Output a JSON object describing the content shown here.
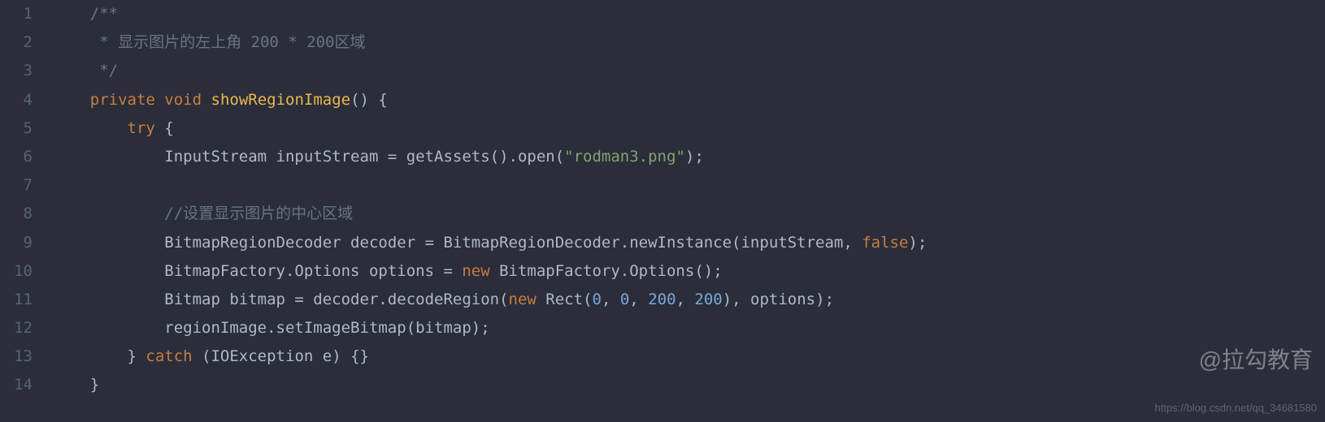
{
  "lines": [
    {
      "num": "1",
      "tokens": [
        {
          "cls": "tk-comment",
          "text": "/**"
        }
      ],
      "indent": 1
    },
    {
      "num": "2",
      "tokens": [
        {
          "cls": "tk-comment",
          "text": " * 显示图片的左上角 200 * 200区域"
        }
      ],
      "indent": 1
    },
    {
      "num": "3",
      "tokens": [
        {
          "cls": "tk-comment",
          "text": " */"
        }
      ],
      "indent": 1
    },
    {
      "num": "4",
      "tokens": [
        {
          "cls": "tk-keyword",
          "text": "private"
        },
        {
          "cls": "",
          "text": " "
        },
        {
          "cls": "tk-keyword",
          "text": "void"
        },
        {
          "cls": "",
          "text": " "
        },
        {
          "cls": "tk-method",
          "text": "showRegionImage"
        },
        {
          "cls": "",
          "text": "() {"
        }
      ],
      "indent": 1
    },
    {
      "num": "5",
      "tokens": [
        {
          "cls": "tk-keyword",
          "text": "try"
        },
        {
          "cls": "",
          "text": " {"
        }
      ],
      "indent": 2
    },
    {
      "num": "6",
      "tokens": [
        {
          "cls": "tk-type",
          "text": "InputStream inputStream = getAssets().open("
        },
        {
          "cls": "tk-string",
          "text": "\"rodman3.png\""
        },
        {
          "cls": "",
          "text": ");"
        }
      ],
      "indent": 3
    },
    {
      "num": "7",
      "tokens": [],
      "indent": 0
    },
    {
      "num": "8",
      "tokens": [
        {
          "cls": "tk-comment",
          "text": "//设置显示图片的中心区域"
        }
      ],
      "indent": 3
    },
    {
      "num": "9",
      "tokens": [
        {
          "cls": "",
          "text": "BitmapRegionDecoder decoder = BitmapRegionDecoder.newInstance(inputStream, "
        },
        {
          "cls": "tk-false",
          "text": "false"
        },
        {
          "cls": "",
          "text": ");"
        }
      ],
      "indent": 3
    },
    {
      "num": "10",
      "tokens": [
        {
          "cls": "",
          "text": "BitmapFactory.Options options = "
        },
        {
          "cls": "tk-new",
          "text": "new"
        },
        {
          "cls": "",
          "text": " BitmapFactory.Options();"
        }
      ],
      "indent": 3
    },
    {
      "num": "11",
      "tokens": [
        {
          "cls": "",
          "text": "Bitmap bitmap = decoder.decodeRegion("
        },
        {
          "cls": "tk-new",
          "text": "new"
        },
        {
          "cls": "",
          "text": " Rect("
        },
        {
          "cls": "tk-number",
          "text": "0"
        },
        {
          "cls": "",
          "text": ", "
        },
        {
          "cls": "tk-number",
          "text": "0"
        },
        {
          "cls": "",
          "text": ", "
        },
        {
          "cls": "tk-number",
          "text": "200"
        },
        {
          "cls": "",
          "text": ", "
        },
        {
          "cls": "tk-number",
          "text": "200"
        },
        {
          "cls": "",
          "text": "), options);"
        }
      ],
      "indent": 3
    },
    {
      "num": "12",
      "tokens": [
        {
          "cls": "",
          "text": "regionImage.setImageBitmap(bitmap);"
        }
      ],
      "indent": 3
    },
    {
      "num": "13",
      "tokens": [
        {
          "cls": "",
          "text": "} "
        },
        {
          "cls": "tk-keyword",
          "text": "catch"
        },
        {
          "cls": "",
          "text": " (IOException e) {}"
        }
      ],
      "indent": 2
    },
    {
      "num": "14",
      "tokens": [
        {
          "cls": "",
          "text": "}"
        }
      ],
      "indent": 1
    }
  ],
  "watermark": "@拉勾教育",
  "attribution": "https://blog.csdn.net/qq_34681580",
  "indent_unit": "    "
}
